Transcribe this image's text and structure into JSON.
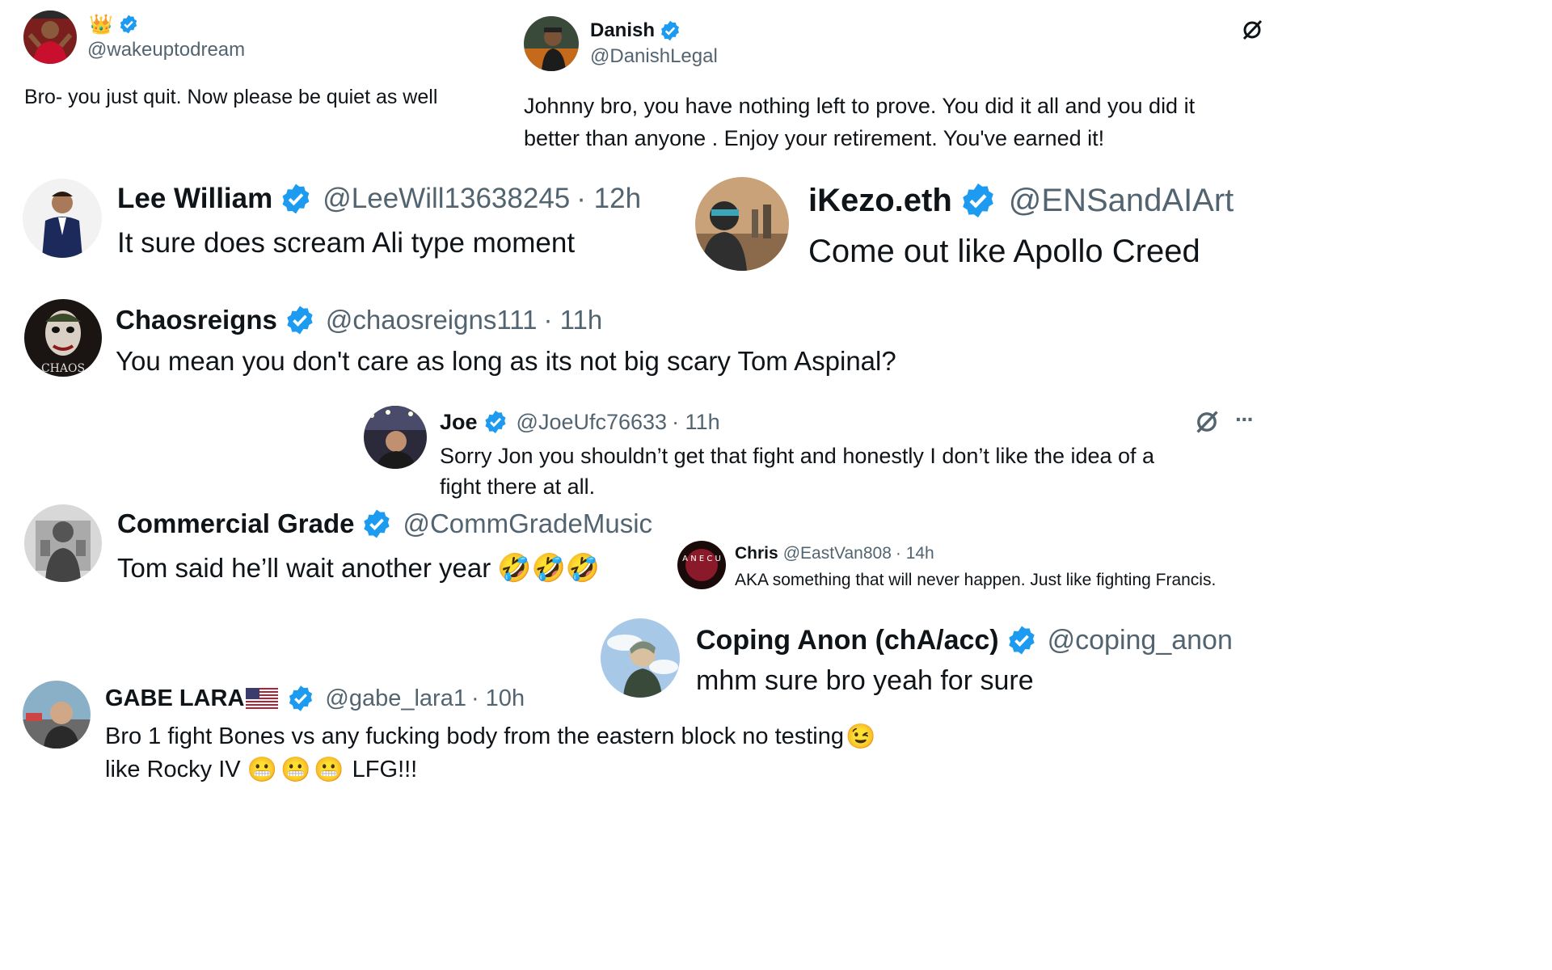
{
  "tweets": [
    {
      "name": "",
      "crown": "👑",
      "handle": "@wakeuptodream",
      "text": "Bro- you just quit. Now please be quiet as well",
      "time": ""
    },
    {
      "name": "Danish",
      "handle": "@DanishLegal",
      "text": "Johnny bro, you have nothing left to prove. You did it all and you did it better than anyone . Enjoy your retirement.  You've earned it!",
      "text_line1": "Johnny bro, you have nothing left to prove. You did it all and you did it",
      "text_line2": "better than anyone . Enjoy your retirement.  You've earned it!"
    },
    {
      "name": "Lee William",
      "handle": "@LeeWill13638245",
      "time": "· 12h",
      "text": "It sure does scream Ali type moment"
    },
    {
      "name": "iKezo.eth",
      "handle": "@ENSandAIArt",
      "text": "Come out like Apollo Creed"
    },
    {
      "name": "Chaosreigns",
      "handle": "@chaosreigns111",
      "time": "· 11h",
      "text": "You mean you don't care as long as its not big scary Tom Aspinal?",
      "avatar_text": "CHAOS"
    },
    {
      "name": "Joe",
      "handle": "@JoeUfc76633",
      "time": "· 11h",
      "text_line1": "Sorry Jon you shouldn’t get that fight and honestly I don’t like the idea of a",
      "text_line2": "fight there at all.",
      "more": "···"
    },
    {
      "name": "Commercial Grade",
      "handle": "@CommGradeMusic",
      "text": "Tom said he’ll wait another year",
      "emoji": "🤣🤣🤣"
    },
    {
      "name": "Chris",
      "handle": "@EastVan808",
      "time": "· 14h",
      "text": "AKA something that will never happen. Just like fighting Francis.",
      "avatar_letters": "A N E C U"
    },
    {
      "name": "Coping Anon (chA/acc)",
      "handle": "@coping_anon",
      "text": "mhm sure bro yeah for sure"
    },
    {
      "name": "GABE LARA🇺🇸",
      "name_text": "GABE LARA",
      "handle": "@gabe_lara1",
      "time": "· 10h",
      "text_line1": "Bro 1 fight Bones vs any fucking body from the eastern block no testing",
      "text_line2_a": "like Rocky IV",
      "text_line2_b": "LFG!!!",
      "emoji_wink": "😉",
      "emoji_grit": "😬😬😬"
    }
  ],
  "colors": {
    "verified": "#1d9bf0",
    "handle": "#536471",
    "text": "#0f1419"
  },
  "icons": [
    "verified-badge-icon",
    "grok-icon",
    "more-icon",
    "flag-us-icon"
  ]
}
